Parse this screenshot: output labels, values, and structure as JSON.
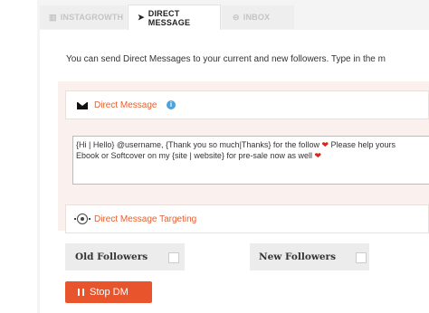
{
  "tabs": [
    {
      "label": "INSTAGROWTH",
      "icon": "chart-icon"
    },
    {
      "label": "DIRECT MESSAGE",
      "icon": "send-icon",
      "active": true
    },
    {
      "label": "INBOX",
      "icon": "inbox-icon"
    }
  ],
  "intro_text": "You can send Direct Messages to your current and new followers. Type in the m",
  "direct_message": {
    "title": "Direct Message",
    "icon": "envelope-icon",
    "info_icon": "info-icon",
    "message_line1": "{Hi | Hello} @username, {Thank you so much|Thanks} for the follow ",
    "message_line1_tail": " Please help yours",
    "message_line2": "Ebook or Softcover on my {site | website} for pre-sale now as well ",
    "heart": "❤"
  },
  "targeting": {
    "title": "Direct Message Targeting",
    "icon": "target-icon"
  },
  "toggles": {
    "old_followers": "Old Followers",
    "new_followers": "New Followers"
  },
  "stop_button": {
    "label": "Stop DM",
    "icon": "pause-icon"
  },
  "colors": {
    "accent": "#e85f2e",
    "button": "#e8552c",
    "heart": "#d9241c"
  }
}
